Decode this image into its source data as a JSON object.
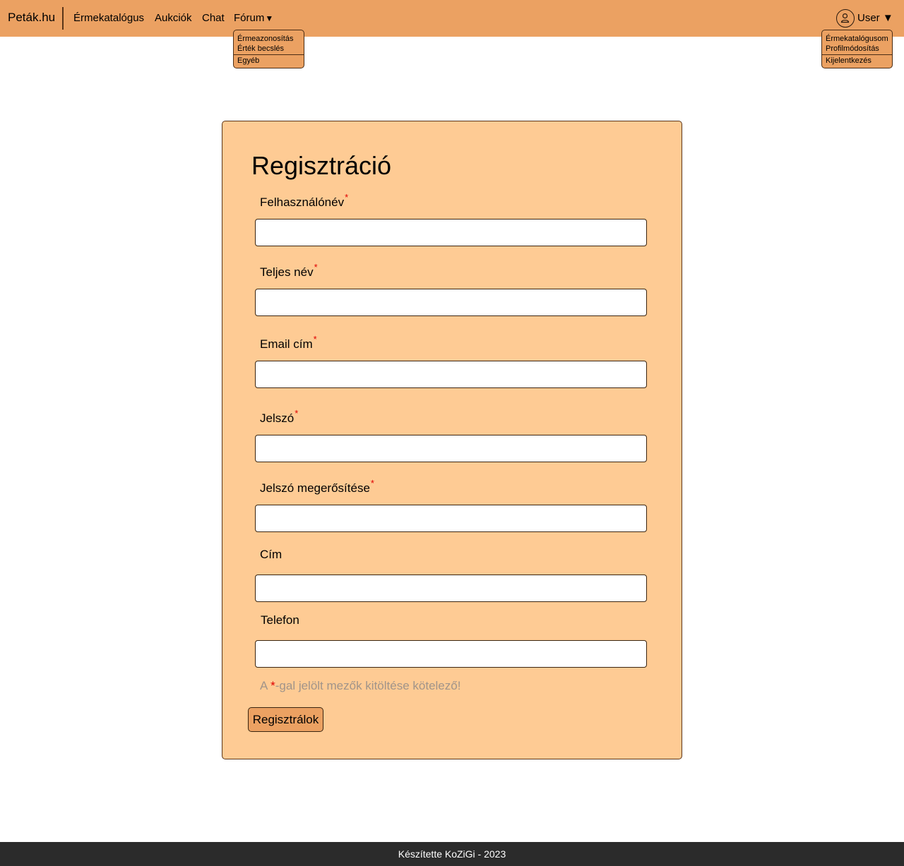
{
  "navbar": {
    "brand": "Peták.hu",
    "links": [
      "Érmekatalógus",
      "Aukciók",
      "Chat"
    ],
    "forum": {
      "label": "Fórum",
      "caret": "▼",
      "items": [
        "Érmeazonosítás",
        "Érték becslés",
        "Egyéb"
      ]
    },
    "user": {
      "label": "User ▼",
      "icon": "user-circle-icon",
      "items": [
        "Érmekatalógusom",
        "Profilmódosítás",
        "Kijelentkezés"
      ]
    }
  },
  "form": {
    "title": "Regisztráció",
    "required_marker": "*",
    "fields": [
      {
        "label": "Felhasználónév",
        "required": true,
        "value": ""
      },
      {
        "label": "Teljes név",
        "required": true,
        "value": ""
      },
      {
        "label": "Email cím",
        "required": true,
        "value": ""
      },
      {
        "label": "Jelszó",
        "required": true,
        "value": ""
      },
      {
        "label": "Jelszó megerősítése",
        "required": true,
        "value": ""
      },
      {
        "label": "Cím",
        "required": false,
        "value": ""
      },
      {
        "label": "Telefon",
        "required": false,
        "value": ""
      }
    ],
    "note_prefix": "A ",
    "note_suffix": "-gal jelölt mezők kitöltése kötelező!",
    "submit_label": "Regisztrálok"
  },
  "footer": {
    "text": "Készítette KoZiGi - 2023"
  },
  "colors": {
    "nav": "#eba162",
    "card": "#fecb94",
    "required": "#e00000",
    "footer": "#2b2b2b"
  }
}
